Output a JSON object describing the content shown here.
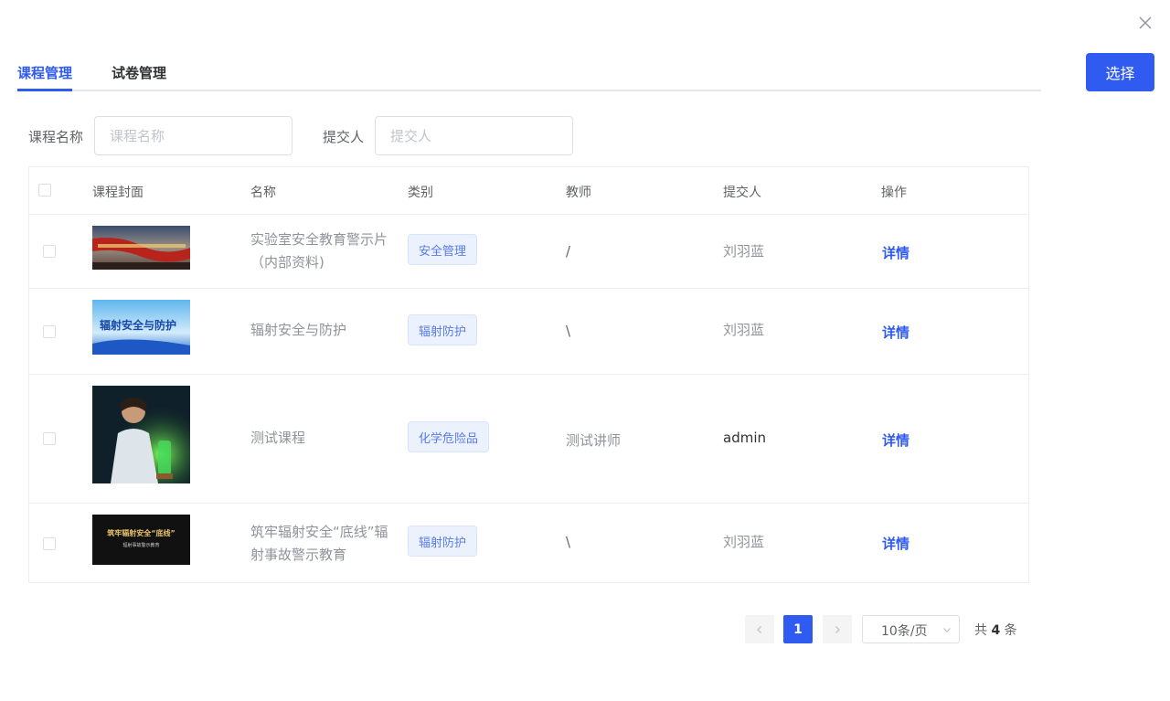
{
  "dialog": {
    "select_label": "选择"
  },
  "tabs": [
    {
      "label": "课程管理",
      "active": true
    },
    {
      "label": "试卷管理",
      "active": false
    }
  ],
  "filters": {
    "course_name": {
      "label": "课程名称",
      "placeholder": "课程名称",
      "value": ""
    },
    "submitter": {
      "label": "提交人",
      "placeholder": "提交人",
      "value": ""
    }
  },
  "table": {
    "columns": [
      "课程封面",
      "名称",
      "类别",
      "教师",
      "提交人",
      "操作"
    ],
    "rows": [
      {
        "cover_icon": "lab-safety-banner-thumbnail",
        "name_line1": "实验室安全教育警示片",
        "name_line2": "（内部资料)",
        "category": "安全管理",
        "teacher": "/",
        "submitter": "刘羽蓝",
        "action": "详情"
      },
      {
        "cover_icon": "radiation-safety-thumbnail",
        "cover_text": "辐射安全与防护",
        "name_line1": "辐射安全与防护",
        "name_line2": "",
        "category": "辐射防护",
        "teacher": "\\",
        "submitter": "刘羽蓝",
        "action": "详情"
      },
      {
        "cover_icon": "chemist-illustration-thumbnail",
        "name_line1": "测试课程",
        "name_line2": "",
        "category": "化学危险品",
        "teacher": "测试讲师",
        "submitter": "admin",
        "action": "详情"
      },
      {
        "cover_icon": "radiation-bottom-line-thumbnail",
        "cover_text": "筑牢辐射安全“底线”",
        "cover_subtext": "辐射事故警示教育",
        "name_line1": "筑牢辐射安全“底线”辐",
        "name_line2": "射事故警示教育",
        "category": "辐射防护",
        "teacher": "\\",
        "submitter": "刘羽蓝",
        "action": "详情"
      }
    ]
  },
  "pagination": {
    "current_page": "1",
    "page_size_label": "10条/页",
    "total_prefix": "共",
    "total_count": "4",
    "total_suffix": "条"
  },
  "colors": {
    "accent": "#2f5bf0",
    "tag_bg": "#ebf1fd",
    "tag_text": "#5b7ce6"
  }
}
